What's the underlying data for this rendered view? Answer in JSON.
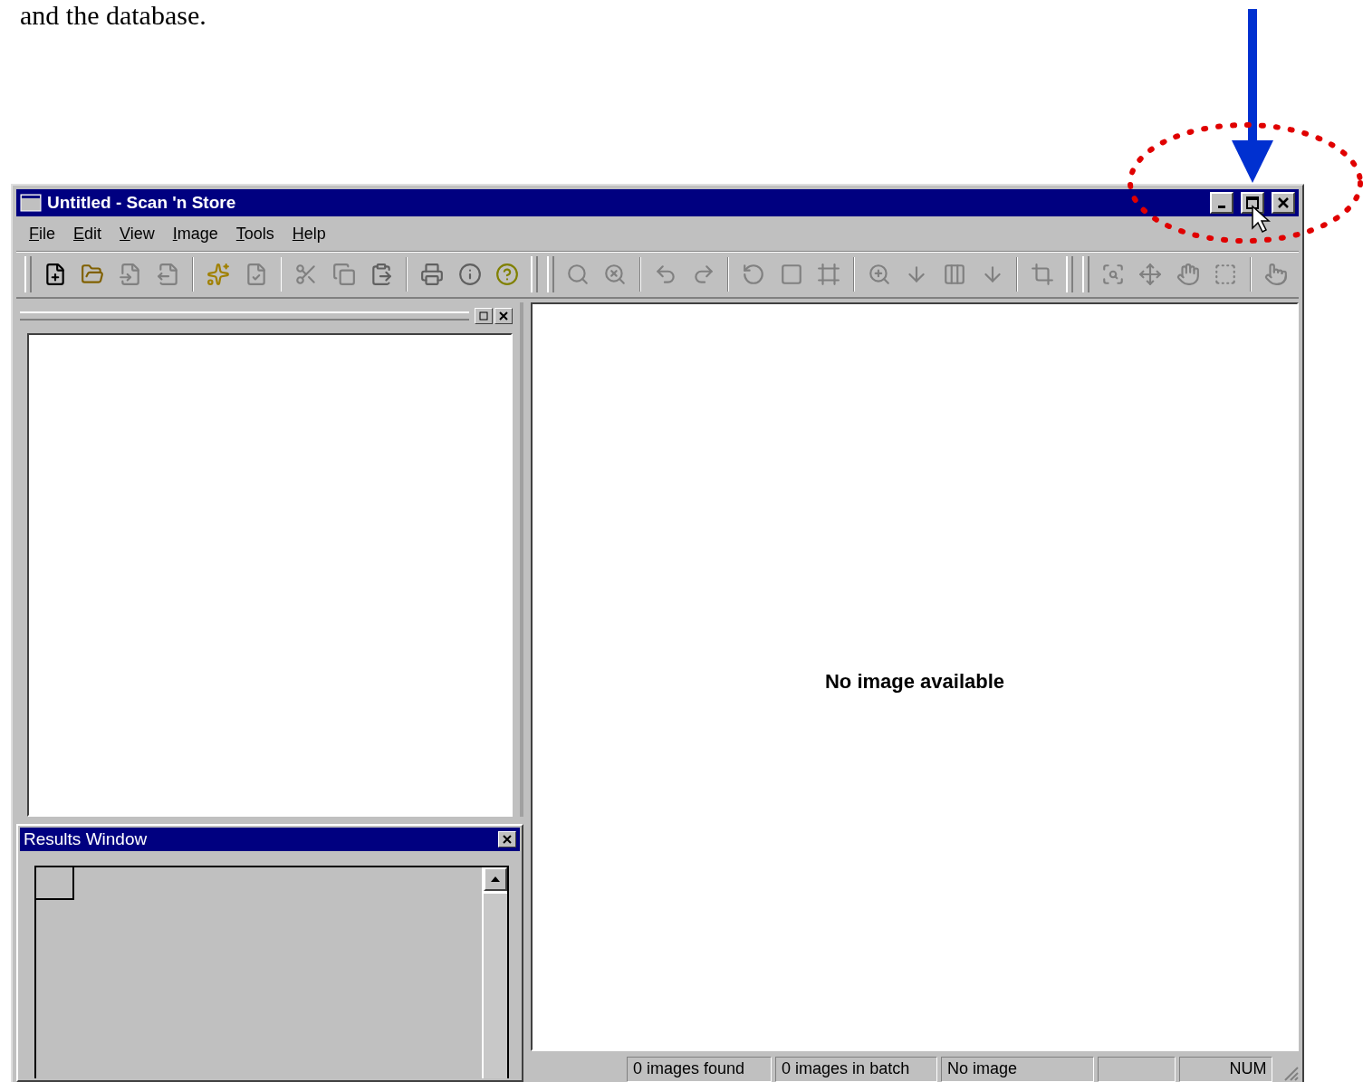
{
  "document_text": "and the database.",
  "window": {
    "title": "Untitled - Scan 'n Store"
  },
  "menu": [
    {
      "label": "File"
    },
    {
      "label": "Edit"
    },
    {
      "label": "View"
    },
    {
      "label": "Image"
    },
    {
      "label": "Tools"
    },
    {
      "label": "Help"
    }
  ],
  "results_window": {
    "title": "Results Window"
  },
  "image_view": {
    "message": "No image available"
  },
  "status_bar": [
    {
      "text": "0 images found"
    },
    {
      "text": "0 images in batch"
    },
    {
      "text": "No image"
    },
    {
      "text": "NUM"
    }
  ]
}
